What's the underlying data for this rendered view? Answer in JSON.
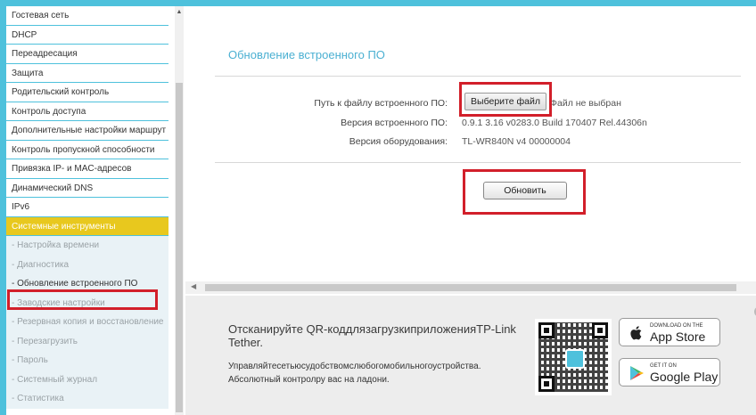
{
  "sidebar": {
    "items": [
      {
        "label": "Гостевая сеть"
      },
      {
        "label": "DHCP"
      },
      {
        "label": "Переадресация"
      },
      {
        "label": "Защита"
      },
      {
        "label": "Родительский контроль"
      },
      {
        "label": "Контроль доступа"
      },
      {
        "label": "Дополнительные настройки маршрут"
      },
      {
        "label": "Контроль пропускной способности"
      },
      {
        "label": "Привязка IP- и MAC-адресов"
      },
      {
        "label": "Динамический DNS"
      },
      {
        "label": "IPv6"
      },
      {
        "label": "Системные инструменты"
      }
    ],
    "subitems": [
      {
        "label": "- Настройка времени"
      },
      {
        "label": "- Диагностика"
      },
      {
        "label": "- Обновление встроенного ПО"
      },
      {
        "label": "- Заводские настройки"
      },
      {
        "label": "- Резервная копия и восстановление"
      },
      {
        "label": "- Перезагрузить"
      },
      {
        "label": "- Пароль"
      },
      {
        "label": "- Системный журнал"
      },
      {
        "label": "- Статистика"
      }
    ]
  },
  "main": {
    "title": "Обновление встроенного ПО",
    "file_path_label": "Путь к файлу встроенного ПО:",
    "choose_file_button": "Выберите файл",
    "no_file_text": "Файл не выбран",
    "firmware_version_label": "Версия встроенного ПО:",
    "firmware_version_value": "0.9.1 3.16 v0283.0 Build 170407 Rel.44306n",
    "hardware_version_label": "Версия оборудования:",
    "hardware_version_value": "TL-WR840N v4 00000004",
    "update_button": "Обновить"
  },
  "banner": {
    "title": "Отсканируйте QR-коддлязагрузкиприложенияTP-Link Tether.",
    "description": "Управляйтесетьюсудобствомслюбогомобильногоустройства. Абсолютный контролру вас на ладони.",
    "app_store_small": "DOWNLOAD ON THE",
    "app_store_big": "App Store",
    "google_play_small": "GET IT ON",
    "google_play_big": "Google Play"
  },
  "colors": {
    "accent": "#4ec1dc",
    "active_menu": "#e8c81e",
    "highlight_box": "#d21f2a",
    "title": "#4bb0d2"
  },
  "icons": [
    "apple-icon",
    "google-play-icon",
    "close-icon",
    "scroll-up-arrow-icon",
    "scroll-left-arrow-icon"
  ]
}
